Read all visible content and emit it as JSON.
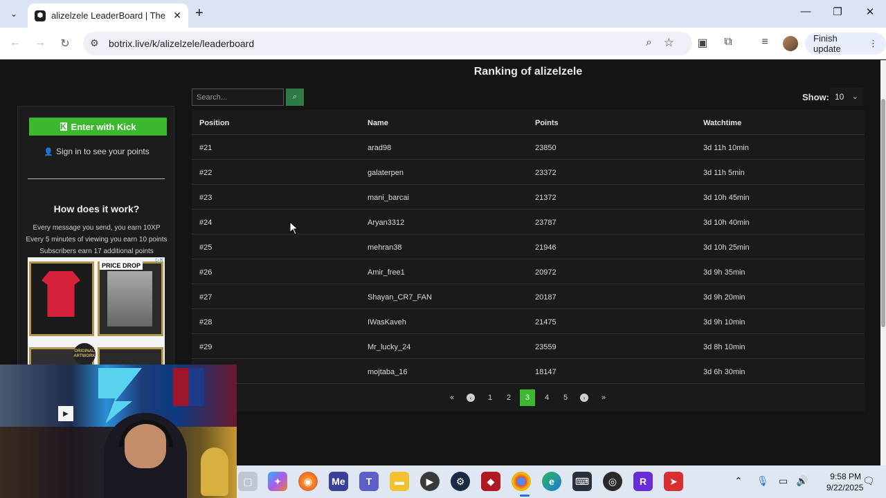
{
  "browser": {
    "tab_title": "alizelzele LeaderBoard | The be",
    "url": "botrix.live/k/alizelzele/leaderboard",
    "finish_update_label": "Finish update"
  },
  "sidebar": {
    "kick_button": "Enter with Kick",
    "kick_logo": "K",
    "sign_in": "Sign in to see your points",
    "how_title": "How does it work?",
    "how_lines": [
      "Every message you send, you earn 10XP",
      "Every 5 minutes of viewing you earn 10 points",
      "Subscribers earn 17 additional points"
    ],
    "ad": {
      "price_drop": "PRICE DROP",
      "badge": "ORIGINAL ARTWORK"
    }
  },
  "main": {
    "title": "Ranking of alizelzele",
    "search_placeholder": "Search...",
    "show_label": "Show:",
    "show_value": "10",
    "columns": [
      "Position",
      "Name",
      "Points",
      "Watchtime"
    ],
    "rows": [
      [
        "#21",
        "arad98",
        "23850",
        "3d 11h 10min"
      ],
      [
        "#22",
        "galaterpen",
        "23372",
        "3d 11h 5min"
      ],
      [
        "#23",
        "mani_barcai",
        "21372",
        "3d 10h 45min"
      ],
      [
        "#24",
        "Aryan3312",
        "23787",
        "3d 10h 40min"
      ],
      [
        "#25",
        "mehran38",
        "21946",
        "3d 10h 25min"
      ],
      [
        "#26",
        "Amir_free1",
        "20972",
        "3d 9h 35min"
      ],
      [
        "#27",
        "Shayan_CR7_FAN",
        "20187",
        "3d 9h 20min"
      ],
      [
        "#28",
        "IWasKaveh",
        "21475",
        "3d 9h 10min"
      ],
      [
        "#29",
        "Mr_lucky_24",
        "23559",
        "3d 8h 10min"
      ],
      [
        "",
        "mojtaba_16",
        "18147",
        "3d 6h 30min"
      ]
    ],
    "pagination": {
      "pages": [
        "1",
        "2",
        "3",
        "4",
        "5"
      ],
      "current": "3"
    }
  },
  "taskbar": {
    "time": "9:58 PM",
    "date": "9/22/2025"
  },
  "colors": {
    "accent_green": "#3bb82f",
    "page_bg": "#141414",
    "panel_bg": "#1a1a1a"
  }
}
